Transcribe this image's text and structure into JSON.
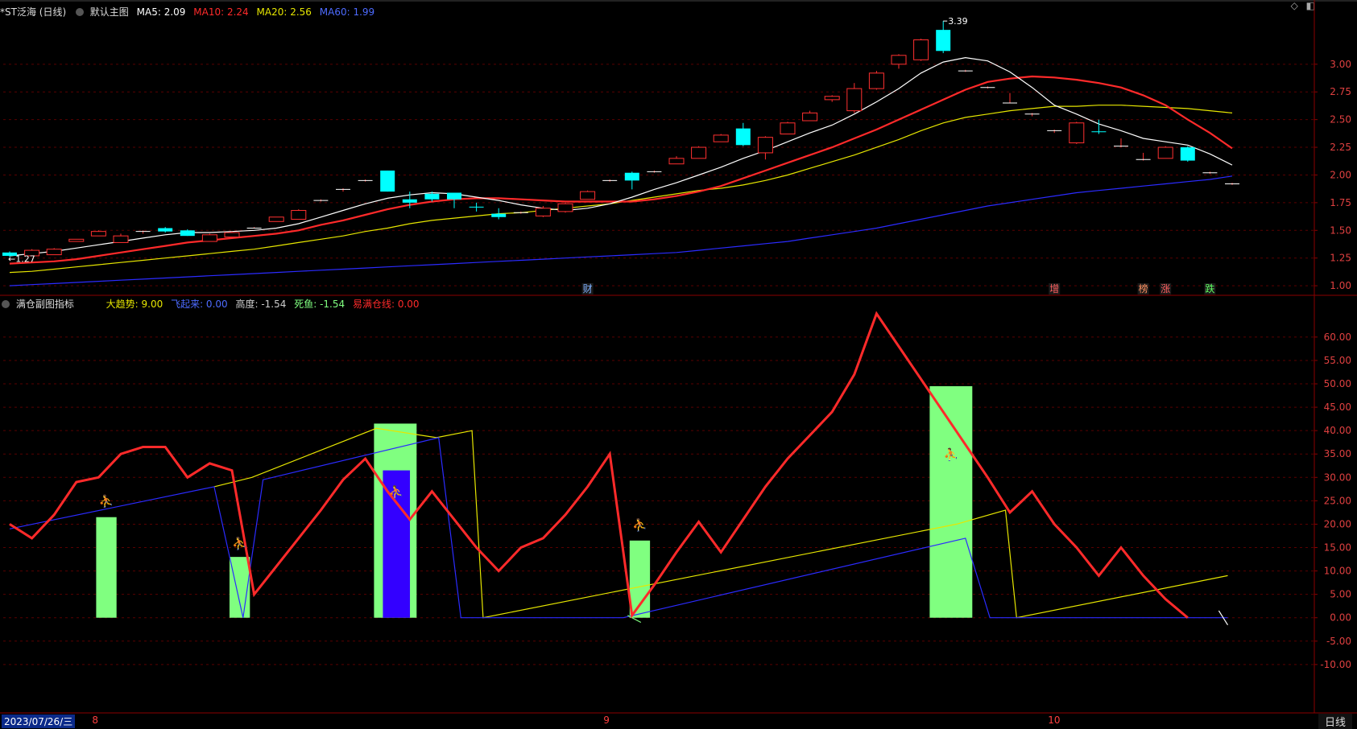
{
  "main_header": {
    "title": "*ST泛海 (日线)",
    "template": "默认主图",
    "ma5": "MA5: 2.09",
    "ma10": "MA10: 2.24",
    "ma20": "MA20: 2.56",
    "ma60": "MA60: 1.99",
    "colors": {
      "ma5": "#ffffff",
      "ma10": "#ff2a2a",
      "ma20": "#e6e600",
      "ma60": "#2b2bff"
    }
  },
  "sub_header": {
    "title": "满仓副图指标",
    "dqs": "大趋势: 9.00",
    "fqy": "飞起来: 0.00",
    "gd": "高度: -1.54",
    "sy": "死鱼: -1.54",
    "ymcx": "易满仓线: 0.00",
    "colors": {
      "dqs": "#e6e600",
      "fqy": "#2b2bff",
      "gd": "#cccccc",
      "sy": "#80ff80",
      "ymcx": "#ff2a2a"
    }
  },
  "date_axis": {
    "start": "2023/07/26/三",
    "month_labels": [
      {
        "label": "8",
        "index": 4
      },
      {
        "label": "9",
        "index": 27
      },
      {
        "label": "10",
        "index": 47
      }
    ]
  },
  "period_tab": "日线",
  "icons": [
    "diamond-icon",
    "window-icon"
  ],
  "chart_data": [
    {
      "type": "candlestick",
      "title": "*ST泛海 (日线)",
      "ylim": [
        0.95,
        3.42
      ],
      "y_ticks": [
        1.0,
        1.25,
        1.5,
        1.75,
        2.0,
        2.25,
        2.5,
        2.75,
        3.0
      ],
      "high_label": "3.39",
      "low_label": "1.27",
      "candles": [
        [
          1.3,
          1.27,
          1.31,
          1.26
        ],
        [
          1.27,
          1.32,
          1.33,
          1.27
        ],
        [
          1.28,
          1.33,
          1.34,
          1.28
        ],
        [
          1.4,
          1.42,
          1.42,
          1.4
        ],
        [
          1.45,
          1.49,
          1.5,
          1.45
        ],
        [
          1.39,
          1.45,
          1.47,
          1.39
        ],
        [
          1.48,
          1.49,
          1.5,
          1.47
        ],
        [
          1.52,
          1.49,
          1.53,
          1.48
        ],
        [
          1.5,
          1.45,
          1.51,
          1.45
        ],
        [
          1.4,
          1.46,
          1.47,
          1.4
        ],
        [
          1.44,
          1.48,
          1.49,
          1.43
        ],
        [
          1.52,
          1.52,
          1.53,
          1.52
        ],
        [
          1.58,
          1.62,
          1.62,
          1.58
        ],
        [
          1.6,
          1.68,
          1.69,
          1.6
        ],
        [
          1.76,
          1.77,
          1.78,
          1.76
        ],
        [
          1.86,
          1.87,
          1.88,
          1.85
        ],
        [
          1.95,
          1.95,
          1.96,
          1.94
        ],
        [
          2.04,
          1.85,
          2.04,
          1.85
        ],
        [
          1.78,
          1.75,
          1.85,
          1.7
        ],
        [
          1.83,
          1.78,
          1.85,
          1.76
        ],
        [
          1.84,
          1.78,
          1.84,
          1.7
        ],
        [
          1.71,
          1.7,
          1.75,
          1.67
        ],
        [
          1.65,
          1.62,
          1.7,
          1.6
        ],
        [
          1.66,
          1.66,
          1.67,
          1.65
        ],
        [
          1.63,
          1.7,
          1.72,
          1.62
        ],
        [
          1.67,
          1.74,
          1.75,
          1.66
        ],
        [
          1.78,
          1.85,
          1.86,
          1.78
        ],
        [
          1.95,
          1.95,
          1.96,
          1.94
        ],
        [
          2.02,
          1.95,
          2.03,
          1.87
        ],
        [
          2.03,
          2.03,
          2.04,
          2.02
        ],
        [
          2.1,
          2.15,
          2.17,
          2.1
        ],
        [
          2.15,
          2.25,
          2.26,
          2.15
        ],
        [
          2.3,
          2.36,
          2.37,
          2.3
        ],
        [
          2.42,
          2.27,
          2.47,
          2.26
        ],
        [
          2.2,
          2.34,
          2.35,
          2.14
        ],
        [
          2.37,
          2.47,
          2.48,
          2.37
        ],
        [
          2.49,
          2.56,
          2.58,
          2.49
        ],
        [
          2.68,
          2.71,
          2.72,
          2.66
        ],
        [
          2.58,
          2.78,
          2.83,
          2.56
        ],
        [
          2.78,
          2.92,
          2.94,
          2.77
        ],
        [
          3.0,
          3.08,
          3.09,
          2.96
        ],
        [
          3.04,
          3.22,
          3.23,
          3.03
        ],
        [
          3.31,
          3.12,
          3.39,
          3.1
        ],
        [
          2.94,
          2.94,
          2.95,
          2.93
        ],
        [
          2.79,
          2.79,
          2.8,
          2.78
        ],
        [
          2.65,
          2.65,
          2.74,
          2.65
        ],
        [
          2.55,
          2.55,
          2.56,
          2.53
        ],
        [
          2.4,
          2.4,
          2.41,
          2.38
        ],
        [
          2.29,
          2.47,
          2.48,
          2.28
        ],
        [
          2.39,
          2.38,
          2.5,
          2.37
        ],
        [
          2.26,
          2.26,
          2.33,
          2.25
        ],
        [
          2.14,
          2.14,
          2.2,
          2.13
        ],
        [
          2.15,
          2.25,
          2.26,
          2.15
        ],
        [
          2.25,
          2.13,
          2.26,
          2.12
        ],
        [
          2.02,
          2.02,
          2.03,
          2.01
        ],
        [
          1.92,
          1.92,
          1.93,
          1.91
        ]
      ],
      "ma5": [
        1.27,
        1.29,
        1.31,
        1.34,
        1.37,
        1.4,
        1.43,
        1.46,
        1.48,
        1.48,
        1.49,
        1.5,
        1.52,
        1.56,
        1.62,
        1.68,
        1.74,
        1.79,
        1.82,
        1.84,
        1.83,
        1.8,
        1.77,
        1.73,
        1.7,
        1.68,
        1.7,
        1.74,
        1.8,
        1.87,
        1.93,
        2.0,
        2.07,
        2.15,
        2.22,
        2.3,
        2.38,
        2.45,
        2.55,
        2.66,
        2.78,
        2.92,
        3.02,
        3.06,
        3.03,
        2.93,
        2.79,
        2.63,
        2.55,
        2.46,
        2.4,
        2.33,
        2.3,
        2.27,
        2.19,
        2.09
      ],
      "ma10": [
        1.2,
        1.21,
        1.22,
        1.24,
        1.27,
        1.3,
        1.33,
        1.36,
        1.39,
        1.41,
        1.43,
        1.45,
        1.47,
        1.5,
        1.55,
        1.59,
        1.64,
        1.69,
        1.73,
        1.76,
        1.78,
        1.79,
        1.79,
        1.78,
        1.77,
        1.76,
        1.76,
        1.76,
        1.76,
        1.78,
        1.81,
        1.85,
        1.9,
        1.97,
        2.04,
        2.11,
        2.18,
        2.25,
        2.33,
        2.41,
        2.5,
        2.59,
        2.68,
        2.77,
        2.84,
        2.87,
        2.89,
        2.88,
        2.86,
        2.83,
        2.79,
        2.72,
        2.63,
        2.5,
        2.38,
        2.24
      ],
      "ma20": [
        1.12,
        1.13,
        1.15,
        1.17,
        1.19,
        1.21,
        1.23,
        1.25,
        1.27,
        1.29,
        1.31,
        1.33,
        1.36,
        1.39,
        1.42,
        1.45,
        1.49,
        1.52,
        1.56,
        1.59,
        1.61,
        1.63,
        1.65,
        1.66,
        1.68,
        1.7,
        1.72,
        1.74,
        1.77,
        1.8,
        1.83,
        1.86,
        1.88,
        1.91,
        1.95,
        2.0,
        2.06,
        2.12,
        2.18,
        2.25,
        2.32,
        2.4,
        2.47,
        2.52,
        2.55,
        2.58,
        2.6,
        2.62,
        2.62,
        2.63,
        2.63,
        2.62,
        2.61,
        2.6,
        2.58,
        2.56
      ],
      "ma60": [
        1.0,
        1.01,
        1.02,
        1.03,
        1.04,
        1.05,
        1.06,
        1.07,
        1.08,
        1.09,
        1.1,
        1.11,
        1.12,
        1.13,
        1.14,
        1.15,
        1.16,
        1.17,
        1.18,
        1.19,
        1.2,
        1.21,
        1.22,
        1.23,
        1.24,
        1.25,
        1.26,
        1.27,
        1.28,
        1.29,
        1.3,
        1.32,
        1.34,
        1.36,
        1.38,
        1.4,
        1.43,
        1.46,
        1.49,
        1.52,
        1.56,
        1.6,
        1.64,
        1.68,
        1.72,
        1.75,
        1.78,
        1.81,
        1.84,
        1.86,
        1.88,
        1.9,
        1.92,
        1.94,
        1.96,
        1.99
      ],
      "markers": [
        {
          "label": "财",
          "index": 26,
          "color": "#7fb0ff"
        },
        {
          "label": "增",
          "index": 47,
          "color": "#ff6060"
        },
        {
          "label": "榜",
          "index": 51,
          "color": "#ff9060"
        },
        {
          "label": "涨",
          "index": 52,
          "color": "#ff6060"
        },
        {
          "label": "跌",
          "index": 54,
          "color": "#60ff60"
        }
      ]
    },
    {
      "type": "line",
      "title": "满仓副图指标",
      "ylim": [
        -20,
        66
      ],
      "y_ticks": [
        -10,
        -5,
        0,
        5,
        10,
        15,
        20,
        25,
        30,
        35,
        40,
        45,
        50,
        55,
        60
      ],
      "bars_green": [
        {
          "from": 4,
          "to": 4.7,
          "value": 21.5
        },
        {
          "from": 10,
          "to": 10.7,
          "value": 13
        },
        {
          "from": 16.5,
          "to": 18.2,
          "value": 41.5
        },
        {
          "from": 28,
          "to": 28.7,
          "value": 16.5
        },
        {
          "from": 41.5,
          "to": 43.2,
          "value": 49.5
        }
      ],
      "bars_blue": [
        {
          "from": 16.9,
          "to": 17.9,
          "value": 31.5
        }
      ],
      "signal_indices": [
        {
          "index": 4.35,
          "value": 24
        },
        {
          "index": 10.35,
          "value": 15
        },
        {
          "index": 17.4,
          "value": 26
        },
        {
          "index": 28.35,
          "value": 19
        },
        {
          "index": 42.35,
          "value": 34
        }
      ],
      "series": [
        {
          "name": "易满仓线",
          "color": "#ff2a2a",
          "values": [
            20,
            17,
            22,
            29,
            30,
            35,
            36.5,
            36.5,
            30,
            33,
            31.5,
            5,
            11,
            17,
            23,
            29.5,
            34,
            27,
            21,
            27,
            21,
            15,
            10,
            15,
            17,
            22,
            28,
            35,
            0.5,
            7,
            14,
            20.5,
            14,
            21,
            28,
            34,
            39,
            44,
            52,
            65,
            58,
            51,
            44,
            37,
            30,
            22.5,
            27,
            20,
            15,
            9,
            15,
            9,
            4,
            0
          ]
        },
        {
          "name": "大趋势",
          "color": "#e6e600",
          "x": [
            9.2,
            10.9,
            16.5,
            19.2,
            20.8,
            21.3,
            42.6,
            44.8,
            45.3,
            54.8
          ],
          "values": [
            28,
            30,
            40.5,
            38.5,
            40,
            0,
            20,
            23,
            0,
            9
          ]
        },
        {
          "name": "飞起来",
          "color": "#2b2bff",
          "x": [
            0,
            9.2,
            10.5,
            11.4,
            19.3,
            20.3,
            27.6,
            43,
            44.1,
            54.8
          ],
          "values": [
            19,
            28,
            0,
            29.5,
            38.5,
            0,
            0,
            17,
            0,
            0
          ]
        },
        {
          "name": "高度",
          "color": "#ffffff",
          "x": [
            54.4,
            54.8
          ],
          "values": [
            1.5,
            -1.54
          ]
        },
        {
          "name": "死鱼",
          "color": "#80ff80",
          "x": [
            27.8,
            28.4
          ],
          "values": [
            0.5,
            -1
          ]
        }
      ]
    }
  ]
}
